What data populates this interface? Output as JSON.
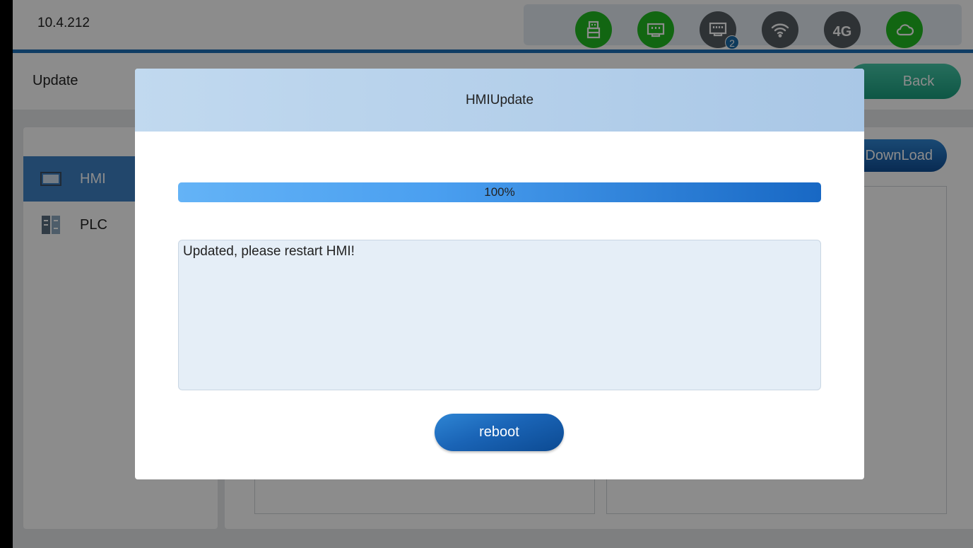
{
  "status_bar": {
    "ip": "10.4.212",
    "icons": [
      {
        "name": "usb-icon",
        "state": "connected",
        "color": "#22bb22"
      },
      {
        "name": "ethernet-icon",
        "state": "connected",
        "color": "#22bb22"
      },
      {
        "name": "ethernet-2-icon",
        "state": "inactive",
        "color": "#555c62",
        "badge": "2"
      },
      {
        "name": "wifi-icon",
        "state": "inactive",
        "color": "#555c62"
      },
      {
        "name": "4g-icon",
        "state": "inactive",
        "color": "#555c62",
        "label": "4G"
      },
      {
        "name": "cloud-icon",
        "state": "connected",
        "color": "#22bb22"
      }
    ]
  },
  "header": {
    "title": "Update",
    "back_label": "Back"
  },
  "sidebar": {
    "items": [
      {
        "label": "HMI",
        "active": true
      },
      {
        "label": "PLC",
        "active": false
      }
    ]
  },
  "main": {
    "download_label": "DownLoad"
  },
  "dialog": {
    "title": "HMIUpdate",
    "progress": {
      "value": 100,
      "text": "100%"
    },
    "message": "Updated, please restart HMI!",
    "reboot_label": "reboot"
  },
  "colors": {
    "accent": "#1e6fb6",
    "connected": "#22bb22",
    "inactive": "#555c62",
    "back_button": "#1a9e7e"
  }
}
